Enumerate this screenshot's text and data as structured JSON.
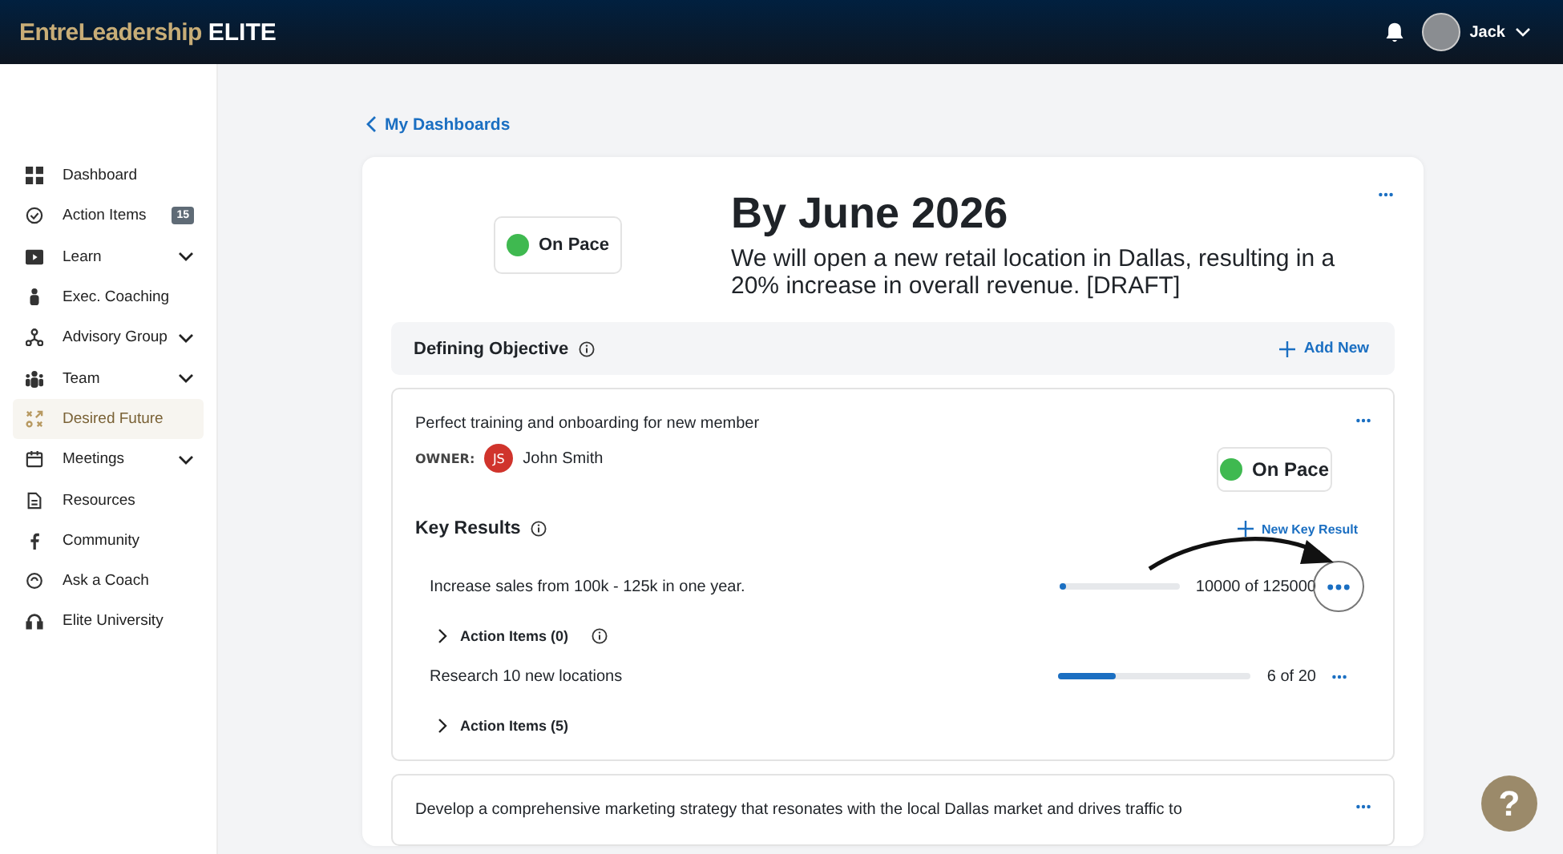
{
  "header": {
    "logo_brand": "EntreLeadership",
    "logo_tier": "ELITE",
    "user_name": "Jack"
  },
  "sidebar": {
    "items": [
      {
        "label": "Dashboard",
        "selected": false,
        "expandable": false
      },
      {
        "label": "Action Items",
        "selected": false,
        "expandable": false,
        "badge": "15"
      },
      {
        "label": "Learn",
        "selected": false,
        "expandable": true
      },
      {
        "label": "Exec. Coaching",
        "selected": false,
        "expandable": false
      },
      {
        "label": "Advisory Group",
        "selected": false,
        "expandable": true
      },
      {
        "label": "Team",
        "selected": false,
        "expandable": true
      },
      {
        "label": "Desired Future",
        "selected": true,
        "expandable": false
      },
      {
        "label": "Meetings",
        "selected": false,
        "expandable": true
      },
      {
        "label": "Resources",
        "selected": false,
        "expandable": false
      },
      {
        "label": "Community",
        "selected": false,
        "expandable": false
      },
      {
        "label": "Ask a Coach",
        "selected": false,
        "expandable": false
      },
      {
        "label": "Elite University",
        "selected": false,
        "expandable": false
      }
    ]
  },
  "back_link": "My Dashboards",
  "help_label": "?",
  "goal": {
    "status": "On Pace",
    "title": "By June 2026",
    "description": "We will open a new retail location in Dallas, resulting in a 20% increase in overall revenue. [DRAFT]"
  },
  "objectives_header": {
    "title": "Defining Objective",
    "action": "Add New"
  },
  "objectives": [
    {
      "title": "Perfect training and onboarding for new member",
      "owner_label": "OWNER:",
      "owner_initials": "JS",
      "owner_name": "John Smith",
      "status": "On Pace",
      "key_results_title": "Key Results",
      "new_key_result": "New Key Result",
      "key_results": [
        {
          "name": "Increase sales from 100k - 125k in one year.",
          "level": 0.04,
          "reading": "10000 of 125000",
          "highlighted": true,
          "action_items": "Action Items (0)",
          "action_info": true
        },
        {
          "name": "Research 10 new locations",
          "level": 0.3,
          "reading": "6 of 20",
          "highlighted": false,
          "action_items": "Action Items (5)",
          "action_info": false
        }
      ]
    },
    {
      "title": "Develop a comprehensive marketing strategy that resonates with the local Dallas market and drives traffic to"
    }
  ]
}
